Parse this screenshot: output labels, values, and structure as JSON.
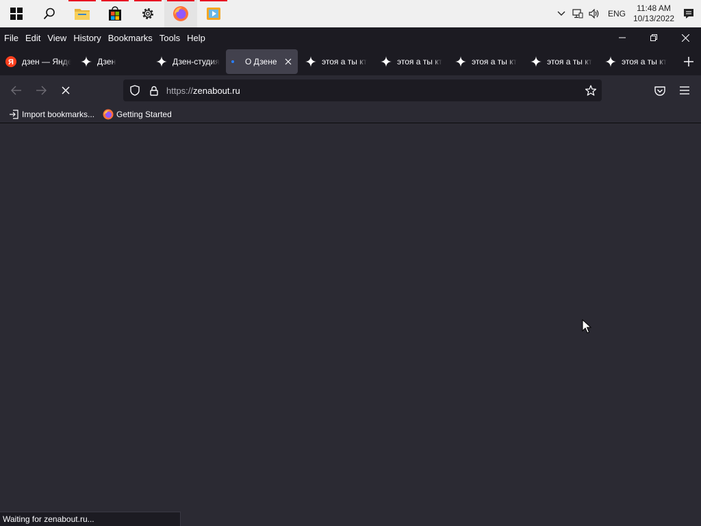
{
  "taskbar": {
    "apps": [
      {
        "name": "start",
        "icon": "windows-logo-icon"
      },
      {
        "name": "search",
        "icon": "search-icon"
      },
      {
        "name": "file-explorer",
        "icon": "folder-icon"
      },
      {
        "name": "store",
        "icon": "store-icon"
      },
      {
        "name": "settings",
        "icon": "gear-icon"
      },
      {
        "name": "firefox",
        "icon": "firefox-icon"
      },
      {
        "name": "media-player",
        "icon": "media-player-icon"
      }
    ],
    "language": "ENG",
    "time": "11:48 AM",
    "date": "10/13/2022"
  },
  "menubar": {
    "items": [
      "File",
      "Edit",
      "View",
      "History",
      "Bookmarks",
      "Tools",
      "Help"
    ]
  },
  "tabs": [
    {
      "label": "дзен — Яндекс",
      "icon": "yandex-icon",
      "selected": false
    },
    {
      "label": "Дзен",
      "icon": "zen-star-icon",
      "selected": false
    },
    {
      "label": "Дзен-студия",
      "icon": "zen-star-icon",
      "selected": false
    },
    {
      "label": "О Дзене",
      "icon": "loading-dot-icon",
      "selected": true
    },
    {
      "label": "этоя а ты кто",
      "icon": "zen-star-icon",
      "selected": false
    },
    {
      "label": "этоя а ты кто",
      "icon": "zen-star-icon",
      "selected": false
    },
    {
      "label": "этоя а ты кто",
      "icon": "zen-star-icon",
      "selected": false
    },
    {
      "label": "этоя а ты кто",
      "icon": "zen-star-icon",
      "selected": false
    },
    {
      "label": "этоя а ты кто",
      "icon": "zen-star-icon",
      "selected": false
    }
  ],
  "navbar": {
    "url_scheme": "https://",
    "url_host": "zenabout.ru"
  },
  "bookmarks": [
    {
      "label": "Import bookmarks...",
      "icon": "import-icon"
    },
    {
      "label": "Getting Started",
      "icon": "firefox-icon"
    }
  ],
  "status": {
    "text": "Waiting for zenabout.ru..."
  },
  "colors": {
    "chrome_dark": "#1c1b22",
    "toolbar": "#2b2a33",
    "selected_tab": "#42414d",
    "text": "#fbfbfe",
    "taskbar": "#f0f0f0",
    "taskbar_indicator": "#e81123"
  }
}
